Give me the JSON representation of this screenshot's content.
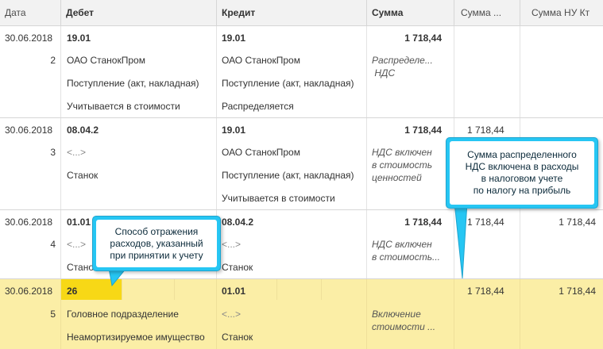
{
  "columns": {
    "date": "Дата",
    "debit": "Дебет",
    "credit": "Кредит",
    "sum": "Сумма",
    "sum_nu_dt": "Сумма ...",
    "sum_nu_kt": "Сумма НУ Кт"
  },
  "rows": [
    {
      "date": "30.06.2018",
      "num": "2",
      "debit": [
        "19.01",
        "ОАО СтанокПром",
        "Поступление (акт, накладная)",
        "Учитывается в стоимости"
      ],
      "credit": [
        "19.01",
        "ОАО СтанокПром",
        "Поступление (акт, накладная)",
        "Распределяется"
      ],
      "sum": "1 718,44",
      "content": [
        "Распределе...",
        " НДС"
      ],
      "nu_dt": "",
      "nu_kt": ""
    },
    {
      "date": "30.06.2018",
      "num": "3",
      "debit": [
        "08.04.2",
        "<...>",
        "Станок",
        ""
      ],
      "credit": [
        "19.01",
        "ОАО СтанокПром",
        "Поступление (акт, накладная)",
        "Учитывается в стоимости"
      ],
      "sum": "1 718,44",
      "content": [
        "НДС включен",
        "в стоимость",
        "ценностей"
      ],
      "nu_dt": "1 718,44",
      "nu_kt": ""
    },
    {
      "date": "30.06.2018",
      "num": "4",
      "debit": [
        "01.01",
        "<...>",
        "Станок"
      ],
      "credit": [
        "08.04.2",
        "<...>",
        "Станок"
      ],
      "sum": "1 718,44",
      "content": [
        "НДС включен",
        "в стоимость..."
      ],
      "nu_dt": "1 718,44",
      "nu_kt": "1 718,44"
    },
    {
      "date": "30.06.2018",
      "num": "5",
      "debit": [
        "26",
        "Головное подразделение",
        "Неамортизируемое имущество"
      ],
      "credit": [
        "01.01",
        "<...>",
        "Станок"
      ],
      "sum": "",
      "content": [
        "Включение",
        "стоимости ..."
      ],
      "nu_dt": "1 718,44",
      "nu_kt": "1 718,44"
    }
  ],
  "callouts": {
    "tax": [
      "Сумма распределенного",
      "НДС включена в расходы",
      "в налоговом учете",
      "по налогу на прибыль"
    ],
    "method": [
      "Способ отражения",
      "расходов, указанный",
      "при принятии к учету"
    ]
  },
  "colors": {
    "selected_row": "#fbeea6",
    "active_cell": "#f7d816",
    "callout_border": "#26c6f3",
    "header_bg": "#f2f2f2"
  }
}
